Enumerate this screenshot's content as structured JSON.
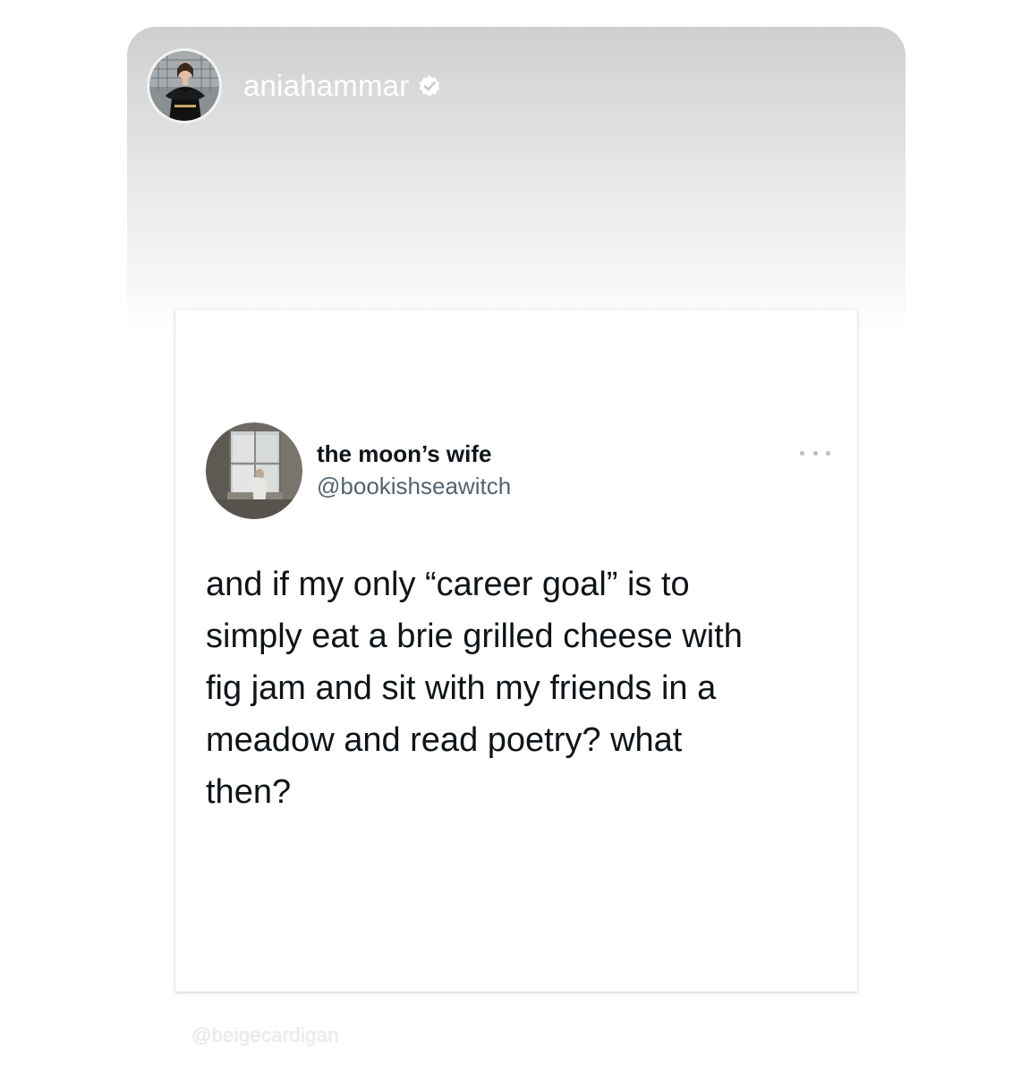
{
  "story": {
    "username": "aniahammar",
    "verified": true,
    "avatar_icon": "profile-photo-woman-black-dress"
  },
  "tweet": {
    "display_name": "the moon’s wife",
    "handle": "@bookishseawitch",
    "avatar_icon": "profile-photo-person-at-window",
    "more_icon": "more-options-icon",
    "text": "and if my only “career goal” is to\nsimply eat a brie grilled cheese with\nfig jam and sit with my friends in a\nmeadow and read poetry? what\nthen?"
  },
  "watermark": {
    "text": "@beigecardigan"
  },
  "colors": {
    "tweet_text": "#0f1419",
    "handle": "#536471",
    "story_header_bg": "#cfcfcf"
  }
}
